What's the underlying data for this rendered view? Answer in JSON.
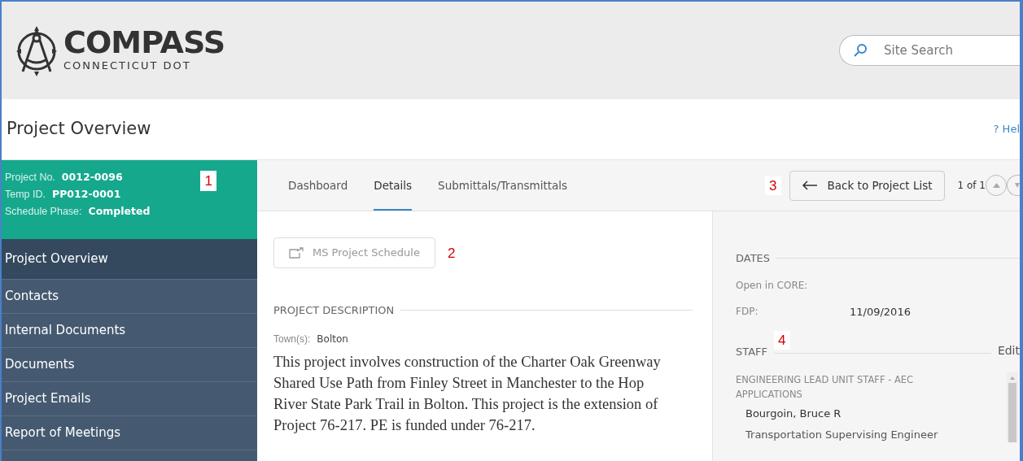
{
  "header": {
    "logo": {
      "title": "COMPASS",
      "subtitle": "CONNECTICUT DOT"
    },
    "search": {
      "placeholder": "Site Search"
    }
  },
  "page_title": "Project Overview",
  "help_link": "? Hel",
  "project_info": [
    {
      "label": "Project No.",
      "value": "0012-0096"
    },
    {
      "label": "Temp ID.",
      "value": "PP012-0001"
    },
    {
      "label": "Schedule Phase:",
      "value": "Completed"
    }
  ],
  "sidebar": {
    "items": [
      {
        "label": "Project Overview",
        "selected": true
      },
      {
        "label": "Contacts",
        "selected": false
      },
      {
        "label": "Internal Documents",
        "selected": false
      },
      {
        "label": "Documents",
        "selected": false
      },
      {
        "label": "Project Emails",
        "selected": false
      },
      {
        "label": "Report of Meetings",
        "selected": false
      }
    ]
  },
  "tabs": [
    {
      "label": "Dashboard",
      "selected": false
    },
    {
      "label": "Details",
      "selected": true
    },
    {
      "label": "Submittals/Transmittals",
      "selected": false
    }
  ],
  "back_button": "Back to Project List",
  "pager": "1 of 1",
  "schedule_button": "MS Project Schedule",
  "description": {
    "heading": "PROJECT DESCRIPTION",
    "town_label": "Town(s):",
    "town": "Bolton",
    "text": "This project involves construction of the Charter Oak Greenway Shared Use Path from Finley Street in Manchester to the Hop River State Park Trail in Bolton. This project is the extension of Project 76-217. PE is funded under 76-217."
  },
  "dates": {
    "heading": "DATES",
    "rows": [
      {
        "label": "Open in CORE:"
      },
      {
        "label": "FDP:",
        "value": "11/09/2016"
      }
    ]
  },
  "staff": {
    "heading": "STAFF",
    "edit": "Edit",
    "group": "ENGINEERING LEAD UNIT STAFF - AEC APPLICATIONS",
    "name": "Bourgoin, Bruce R",
    "role": "Transportation Supervising Engineer"
  },
  "annotations": [
    "1",
    "2",
    "3",
    "4"
  ]
}
